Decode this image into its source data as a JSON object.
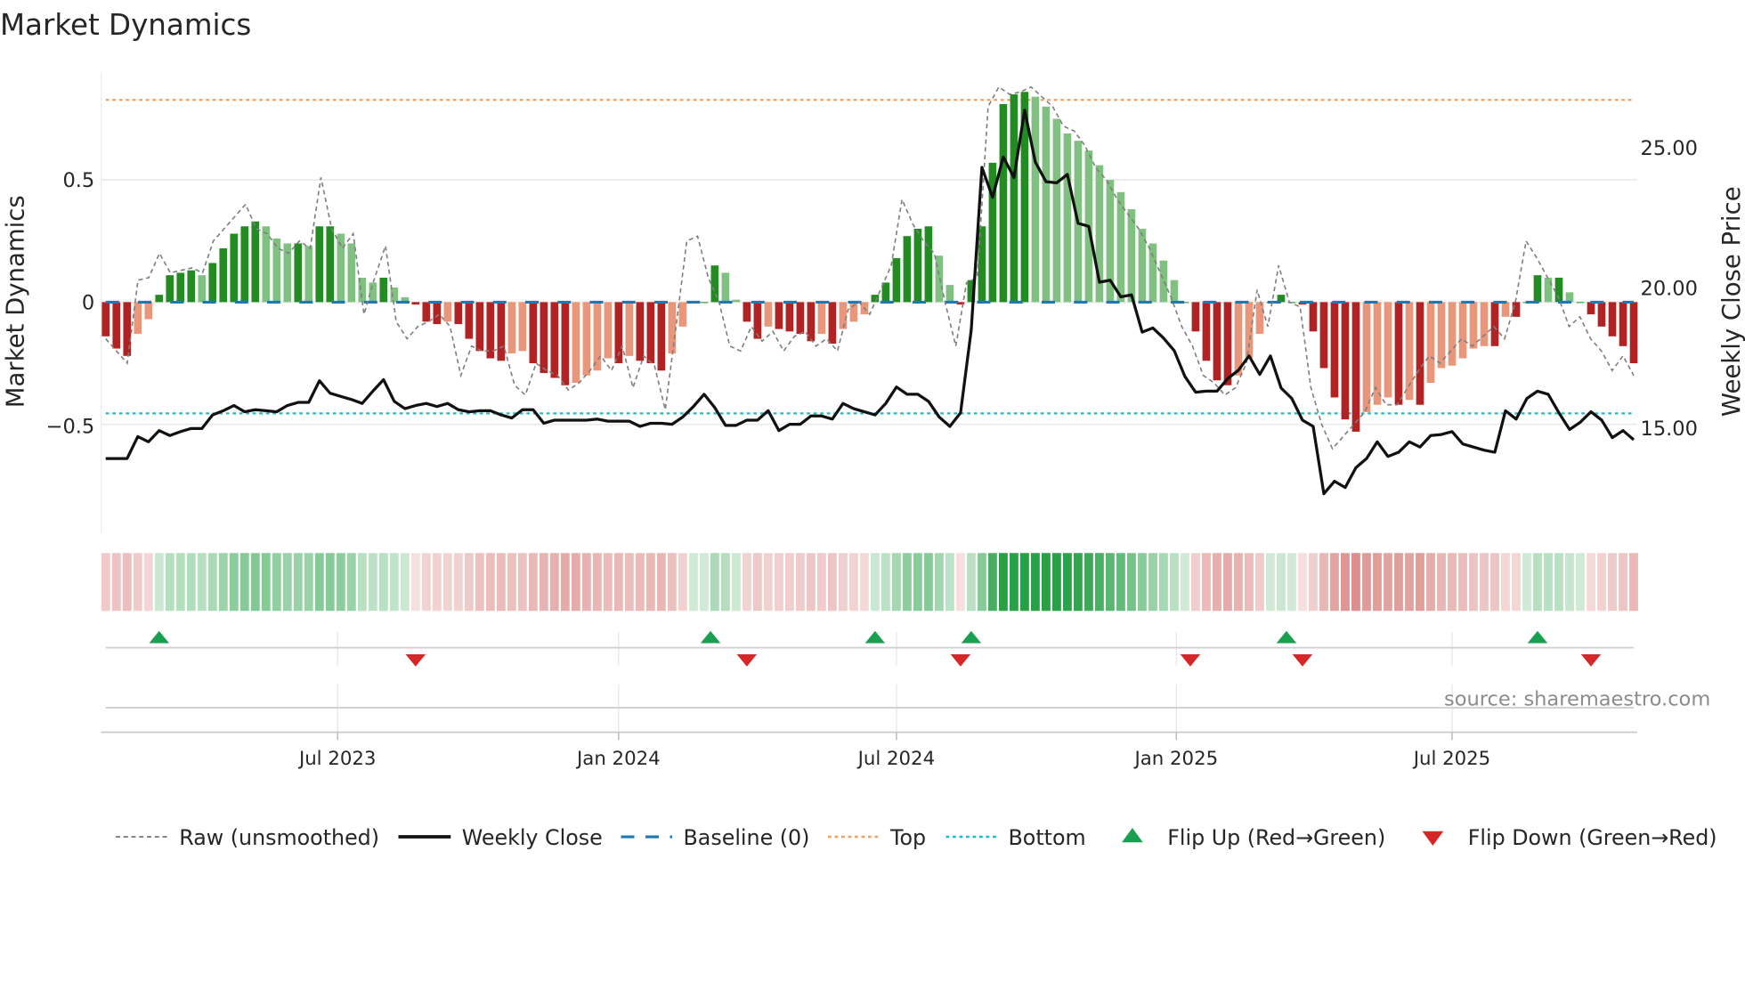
{
  "chart_data": {
    "type": "bar",
    "title": "Market Dynamics",
    "ylabel": "Market Dynamics",
    "y2label": "Weekly Close Price",
    "ylim": [
      -0.94,
      0.94
    ],
    "y2lim": [
      10.6,
      28.2
    ],
    "yticks": [
      {
        "v": 0.5,
        "label": "0.5"
      },
      {
        "v": 0,
        "label": "0"
      },
      {
        "v": -0.5,
        "label": "−0.5"
      }
    ],
    "y2ticks": [
      {
        "v": 25,
        "label": "25.00"
      },
      {
        "v": 20,
        "label": "20.00"
      },
      {
        "v": 15,
        "label": "15.00"
      }
    ],
    "xticks": [
      {
        "week": 21.7,
        "label": "Jul 2023"
      },
      {
        "week": 48.0,
        "label": "Jan 2024"
      },
      {
        "week": 74.0,
        "label": "Jul 2024"
      },
      {
        "week": 100.2,
        "label": "Jan 2025"
      },
      {
        "week": 126.0,
        "label": "Jul 2025"
      }
    ],
    "top_level": 0.827,
    "bottom_level": -0.455,
    "baseline": 0,
    "momentum": [
      -0.14,
      -0.19,
      -0.22,
      -0.13,
      -0.07,
      0.03,
      0.11,
      0.12,
      0.13,
      0.11,
      0.16,
      0.22,
      0.28,
      0.31,
      0.33,
      0.31,
      0.26,
      0.24,
      0.24,
      0.23,
      0.31,
      0.31,
      0.28,
      0.24,
      0.1,
      0.08,
      0.1,
      0.06,
      0.02,
      -0.01,
      -0.08,
      -0.09,
      -0.08,
      -0.09,
      -0.15,
      -0.2,
      -0.23,
      -0.24,
      -0.21,
      -0.2,
      -0.25,
      -0.29,
      -0.31,
      -0.34,
      -0.33,
      -0.3,
      -0.28,
      -0.23,
      -0.25,
      -0.22,
      -0.24,
      -0.25,
      -0.28,
      -0.21,
      -0.1,
      0.0,
      0.0,
      0.15,
      0.12,
      0.01,
      -0.08,
      -0.15,
      -0.1,
      -0.11,
      -0.12,
      -0.13,
      -0.16,
      -0.13,
      -0.17,
      -0.11,
      -0.08,
      -0.05,
      0.03,
      0.08,
      0.18,
      0.27,
      0.3,
      0.31,
      0.19,
      0.07,
      -0.01,
      0.09,
      0.31,
      0.57,
      0.81,
      0.85,
      0.86,
      0.84,
      0.8,
      0.75,
      0.69,
      0.66,
      0.62,
      0.56,
      0.5,
      0.45,
      0.38,
      0.3,
      0.24,
      0.17,
      0.09,
      0.0,
      -0.12,
      -0.24,
      -0.32,
      -0.34,
      -0.3,
      -0.23,
      -0.13,
      0.0,
      0.03,
      0.0,
      -0.01,
      -0.12,
      -0.27,
      -0.39,
      -0.48,
      -0.53,
      -0.45,
      -0.42,
      -0.39,
      -0.42,
      -0.4,
      -0.42,
      -0.33,
      -0.27,
      -0.26,
      -0.23,
      -0.19,
      -0.18,
      -0.18,
      -0.06,
      -0.06,
      0.0,
      0.11,
      0.1,
      0.1,
      0.04,
      0.0,
      -0.05,
      -0.1,
      -0.14,
      -0.18,
      -0.25
    ],
    "raw": [
      -0.15,
      -0.2,
      -0.25,
      0.09,
      0.1,
      0.2,
      0.12,
      0.13,
      0.14,
      0.12,
      0.25,
      0.3,
      0.35,
      0.4,
      0.3,
      0.28,
      0.22,
      0.2,
      0.25,
      0.22,
      0.51,
      0.3,
      0.22,
      0.28,
      -0.05,
      0.1,
      0.23,
      -0.08,
      -0.15,
      -0.1,
      -0.08,
      -0.05,
      -0.1,
      -0.3,
      -0.18,
      -0.2,
      -0.2,
      -0.18,
      -0.34,
      -0.38,
      -0.25,
      -0.28,
      -0.3,
      -0.36,
      -0.33,
      -0.28,
      -0.22,
      -0.28,
      -0.18,
      -0.35,
      -0.22,
      -0.26,
      -0.44,
      -0.1,
      0.25,
      0.27,
      0.1,
      0.0,
      -0.18,
      -0.2,
      -0.1,
      -0.16,
      -0.12,
      -0.2,
      -0.14,
      -0.12,
      -0.18,
      -0.15,
      -0.2,
      -0.03,
      0.0,
      -0.05,
      0.05,
      0.15,
      0.42,
      0.32,
      0.25,
      0.2,
      0.0,
      -0.18,
      0.08,
      0.1,
      0.8,
      0.88,
      0.85,
      0.86,
      0.88,
      0.84,
      0.8,
      0.72,
      0.7,
      0.64,
      0.55,
      0.5,
      0.42,
      0.36,
      0.3,
      0.22,
      0.12,
      0.02,
      -0.1,
      -0.18,
      -0.3,
      -0.33,
      -0.38,
      -0.35,
      -0.25,
      0.05,
      -0.1,
      0.15,
      0.0,
      -0.02,
      -0.35,
      -0.5,
      -0.6,
      -0.55,
      -0.5,
      -0.45,
      -0.35,
      -0.42,
      -0.42,
      -0.35,
      -0.28,
      -0.22,
      -0.25,
      -0.2,
      -0.15,
      -0.18,
      -0.14,
      -0.1,
      -0.15,
      0.0,
      0.25,
      0.18,
      0.1,
      0.02,
      -0.1,
      -0.06,
      -0.15,
      -0.2,
      -0.28,
      -0.22,
      -0.3
    ],
    "weekly_close": [
      13.41,
      13.41,
      13.41,
      14.25,
      14.05,
      14.48,
      14.29,
      14.44,
      14.56,
      14.56,
      15.08,
      15.24,
      15.44,
      15.2,
      15.28,
      15.24,
      15.2,
      15.44,
      15.56,
      15.56,
      16.39,
      15.91,
      15.79,
      15.67,
      15.52,
      15.99,
      16.43,
      15.6,
      15.32,
      15.44,
      15.52,
      15.4,
      15.52,
      15.28,
      15.2,
      15.24,
      15.24,
      15.08,
      14.96,
      15.28,
      15.28,
      14.76,
      14.88,
      14.88,
      14.88,
      14.88,
      14.92,
      14.84,
      14.84,
      14.84,
      14.64,
      14.76,
      14.76,
      14.72,
      15.0,
      15.4,
      15.87,
      15.36,
      14.68,
      14.68,
      14.88,
      14.88,
      15.24,
      14.48,
      14.72,
      14.72,
      15.04,
      15.04,
      14.92,
      15.52,
      15.32,
      15.2,
      15.08,
      15.52,
      16.15,
      15.87,
      15.87,
      15.6,
      15.0,
      14.64,
      15.16,
      18.33,
      24.56,
      23.41,
      24.96,
      24.17,
      26.75,
      24.76,
      24.01,
      23.97,
      24.29,
      22.42,
      22.3,
      20.16,
      20.24,
      19.6,
      19.68,
      18.25,
      18.41,
      18.02,
      17.54,
      16.55,
      15.95,
      15.99,
      15.99,
      16.47,
      16.79,
      17.34,
      16.63,
      17.34,
      16.11,
      15.71,
      14.88,
      14.64,
      12.06,
      12.54,
      12.3,
      13.06,
      13.41,
      14.05,
      13.49,
      13.65,
      14.05,
      13.85,
      14.29,
      14.33,
      14.44,
      13.97,
      13.85,
      13.73,
      13.65,
      15.24,
      14.92,
      15.71,
      15.99,
      15.87,
      15.16,
      14.52,
      14.8,
      15.2,
      14.88,
      14.21,
      14.48,
      14.13
    ],
    "flip_up_weeks": [
      5,
      56.6,
      72,
      81,
      110.5,
      134
    ],
    "flip_down_weeks": [
      29,
      60,
      80,
      101.5,
      112,
      139
    ],
    "colors": {
      "up_strong": "#228b22",
      "up_weak": "#80c080",
      "down_strong": "#b22222",
      "down_weak": "#e9967a",
      "raw": "#7f7f7f",
      "close": "#111111",
      "baseline": "#1f77b4",
      "top": "#f0a060",
      "bottom": "#17becf",
      "flip_up": "#18a050",
      "flip_down": "#d62728"
    },
    "legend": {
      "placement": "bottom",
      "items": [
        {
          "label": "Raw (unsmoothed)"
        },
        {
          "label": "Weekly Close"
        },
        {
          "label": "Baseline (0)"
        },
        {
          "label": "Top"
        },
        {
          "label": "Bottom"
        },
        {
          "label": "Flip Up (Red→Green)"
        },
        {
          "label": "Flip Down (Green→Red)"
        }
      ]
    },
    "source": "source: sharemaestro.com"
  }
}
